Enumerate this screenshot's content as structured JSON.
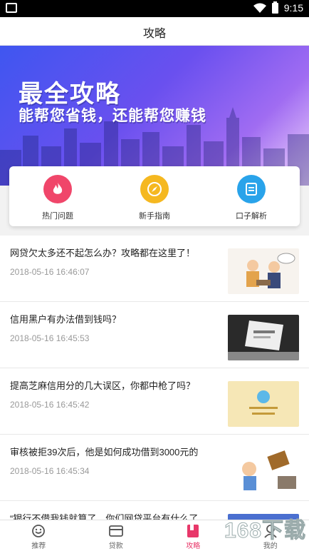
{
  "status": {
    "time": "9:15"
  },
  "header": {
    "title": "攻略"
  },
  "banner": {
    "headline": "最全攻略",
    "subline": "能帮您省钱，还能帮您赚钱"
  },
  "quick": [
    {
      "label": "热门问题",
      "icon": "flame-icon",
      "color": "#f0466a"
    },
    {
      "label": "新手指南",
      "icon": "compass-icon",
      "color": "#f5b820"
    },
    {
      "label": "口子解析",
      "icon": "document-icon",
      "color": "#29a3ea"
    }
  ],
  "articles": [
    {
      "title": "网贷欠太多还不起怎么办？攻略都在这里了！",
      "time": "2018-05-16 16:46:07"
    },
    {
      "title": "信用黑户有办法借到钱吗？",
      "time": "2018-05-16 16:45:53"
    },
    {
      "title": "提高芝麻信用分的几大误区，你都中枪了吗？",
      "time": "2018-05-16 16:45:42"
    },
    {
      "title": "审核被拒39次后，他是如何成功借到3000元的",
      "time": "2018-05-16 16:45:34"
    },
    {
      "title": "“银行不借我钱就算了，你们网贷平台有什么了不起…",
      "time": ""
    }
  ],
  "tabs": [
    {
      "label": "推荐",
      "icon": "recommend-icon"
    },
    {
      "label": "贷款",
      "icon": "card-icon"
    },
    {
      "label": "攻略",
      "icon": "book-icon",
      "active": true
    },
    {
      "label": "我的",
      "icon": "user-icon"
    }
  ],
  "colors": {
    "accent": "#e8386a"
  },
  "watermark": "168下载"
}
